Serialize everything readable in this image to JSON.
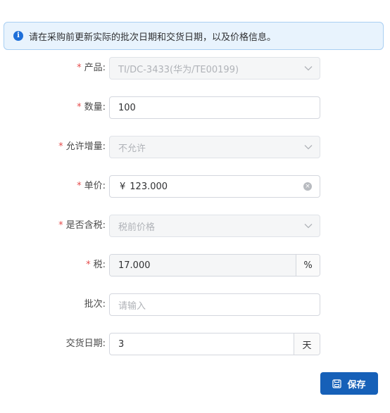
{
  "alert": {
    "icon": "info-icon",
    "text": "请在采购前更新实际的批次日期和交货日期，以及价格信息。"
  },
  "form": {
    "product": {
      "label": "产品:",
      "required": true,
      "value": "TI/DC-3433(华为/TE00199)",
      "disabled": true
    },
    "quantity": {
      "label": "数量:",
      "required": true,
      "value": "100"
    },
    "allow_increase": {
      "label": "允许增量:",
      "required": true,
      "value": "不允许",
      "disabled": true
    },
    "unit_price": {
      "label": "单价:",
      "required": true,
      "prefix": "¥",
      "value": "123.000"
    },
    "tax_included": {
      "label": "是否含税:",
      "required": true,
      "value": "税前价格",
      "disabled": true
    },
    "tax": {
      "label": "税:",
      "required": true,
      "value": "17.000",
      "suffix": "%",
      "disabled": true
    },
    "batch": {
      "label": "批次:",
      "required": false,
      "placeholder": "请输入"
    },
    "delivery_date": {
      "label": "交货日期:",
      "required": false,
      "value": "3",
      "suffix": "天"
    }
  },
  "required_mark": "*",
  "save_button": {
    "label": "保存",
    "icon": "save-icon"
  },
  "colors": {
    "primary": "#1660b8",
    "alert_bg": "#e8f3fd",
    "alert_border": "#a9cff3",
    "required": "#e54b4b"
  }
}
